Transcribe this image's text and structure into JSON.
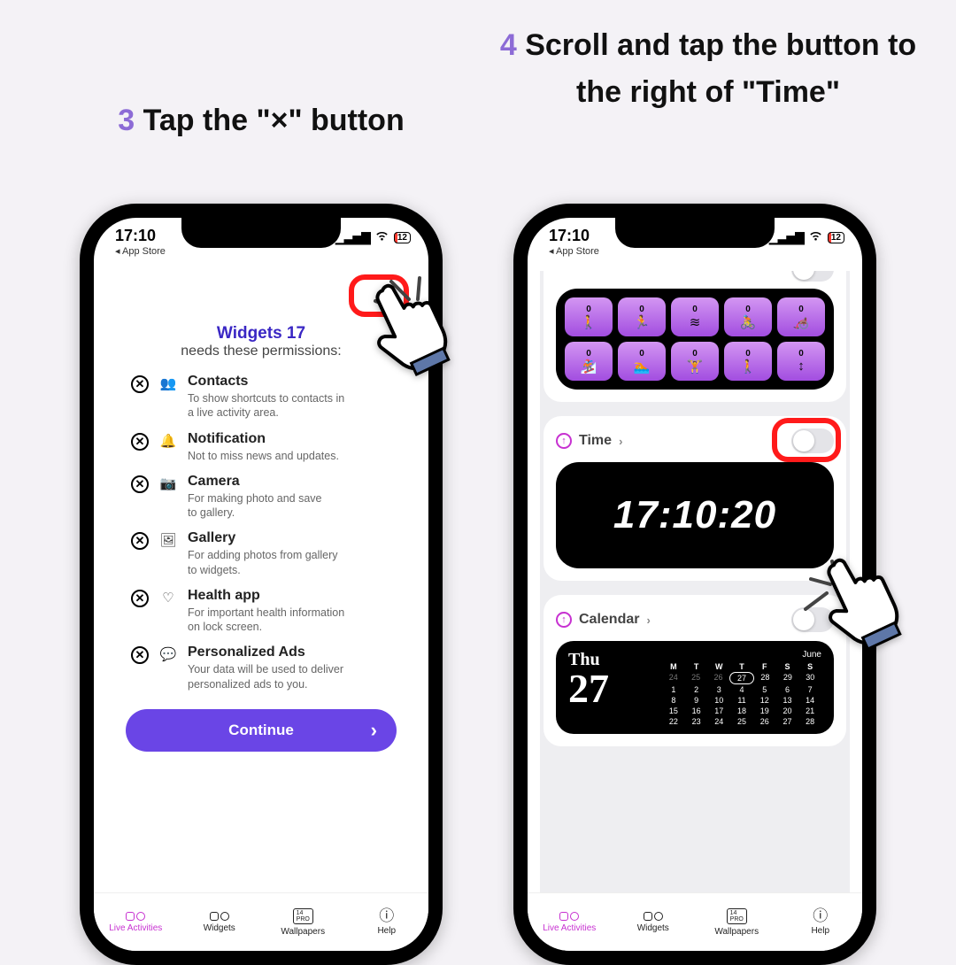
{
  "step3": {
    "num": "3",
    "prefix": "Tap ",
    "bold": "the \"×\" button"
  },
  "step4": {
    "num": "4",
    "text": "Scroll and tap the button to the right of \"Time\""
  },
  "status": {
    "time": "17:10",
    "back": "App Store",
    "battery": "12"
  },
  "permissions": {
    "title": "Widgets 17",
    "subtitle": "needs these permissions:",
    "items": [
      {
        "sym": "👥",
        "name": "Contacts",
        "desc": "To show shortcuts to contacts in\na live activity area."
      },
      {
        "sym": "🔔",
        "name": "Notification",
        "desc": "Not to miss news and updates."
      },
      {
        "sym": "📷",
        "name": "Camera",
        "desc": "For making photo and save\nto gallery."
      },
      {
        "sym": "🖼",
        "name": "Gallery",
        "desc": "For adding photos from gallery\nto widgets."
      },
      {
        "sym": "♡",
        "name": "Health app",
        "desc": "For important health information\non lock screen."
      },
      {
        "sym": "💬",
        "name": "Personalized Ads",
        "desc": "Your data will be used to deliver\npersonalized ads to you."
      }
    ],
    "continue": "Continue"
  },
  "widgets": {
    "activity_values": [
      "0",
      "0",
      "0",
      "0",
      "0",
      "0",
      "0",
      "0",
      "0",
      "0"
    ],
    "activity_glyphs": [
      "🚶",
      "🏃",
      "≋",
      "🚴",
      "🦽",
      "🏂",
      "🏊",
      "🏋",
      "🚶",
      "↕"
    ],
    "time": {
      "label": "Time",
      "clock": "17:10:20"
    },
    "calendar": {
      "label": "Calendar",
      "dow": "Thu",
      "day": "27",
      "month": "June",
      "head": [
        "M",
        "T",
        "W",
        "T",
        "F",
        "S",
        "S"
      ],
      "rows": [
        [
          "24",
          "25",
          "26",
          "27",
          "28",
          "29",
          "30"
        ],
        [
          "1",
          "2",
          "3",
          "4",
          "5",
          "6",
          "7"
        ],
        [
          "8",
          "9",
          "10",
          "11",
          "12",
          "13",
          "14"
        ],
        [
          "15",
          "16",
          "17",
          "18",
          "19",
          "20",
          "21"
        ],
        [
          "22",
          "23",
          "24",
          "25",
          "26",
          "27",
          "28"
        ]
      ]
    }
  },
  "tabs": [
    "Live Activities",
    "Widgets",
    "Wallpapers",
    "Help"
  ],
  "wall_label": "14\nPRO"
}
